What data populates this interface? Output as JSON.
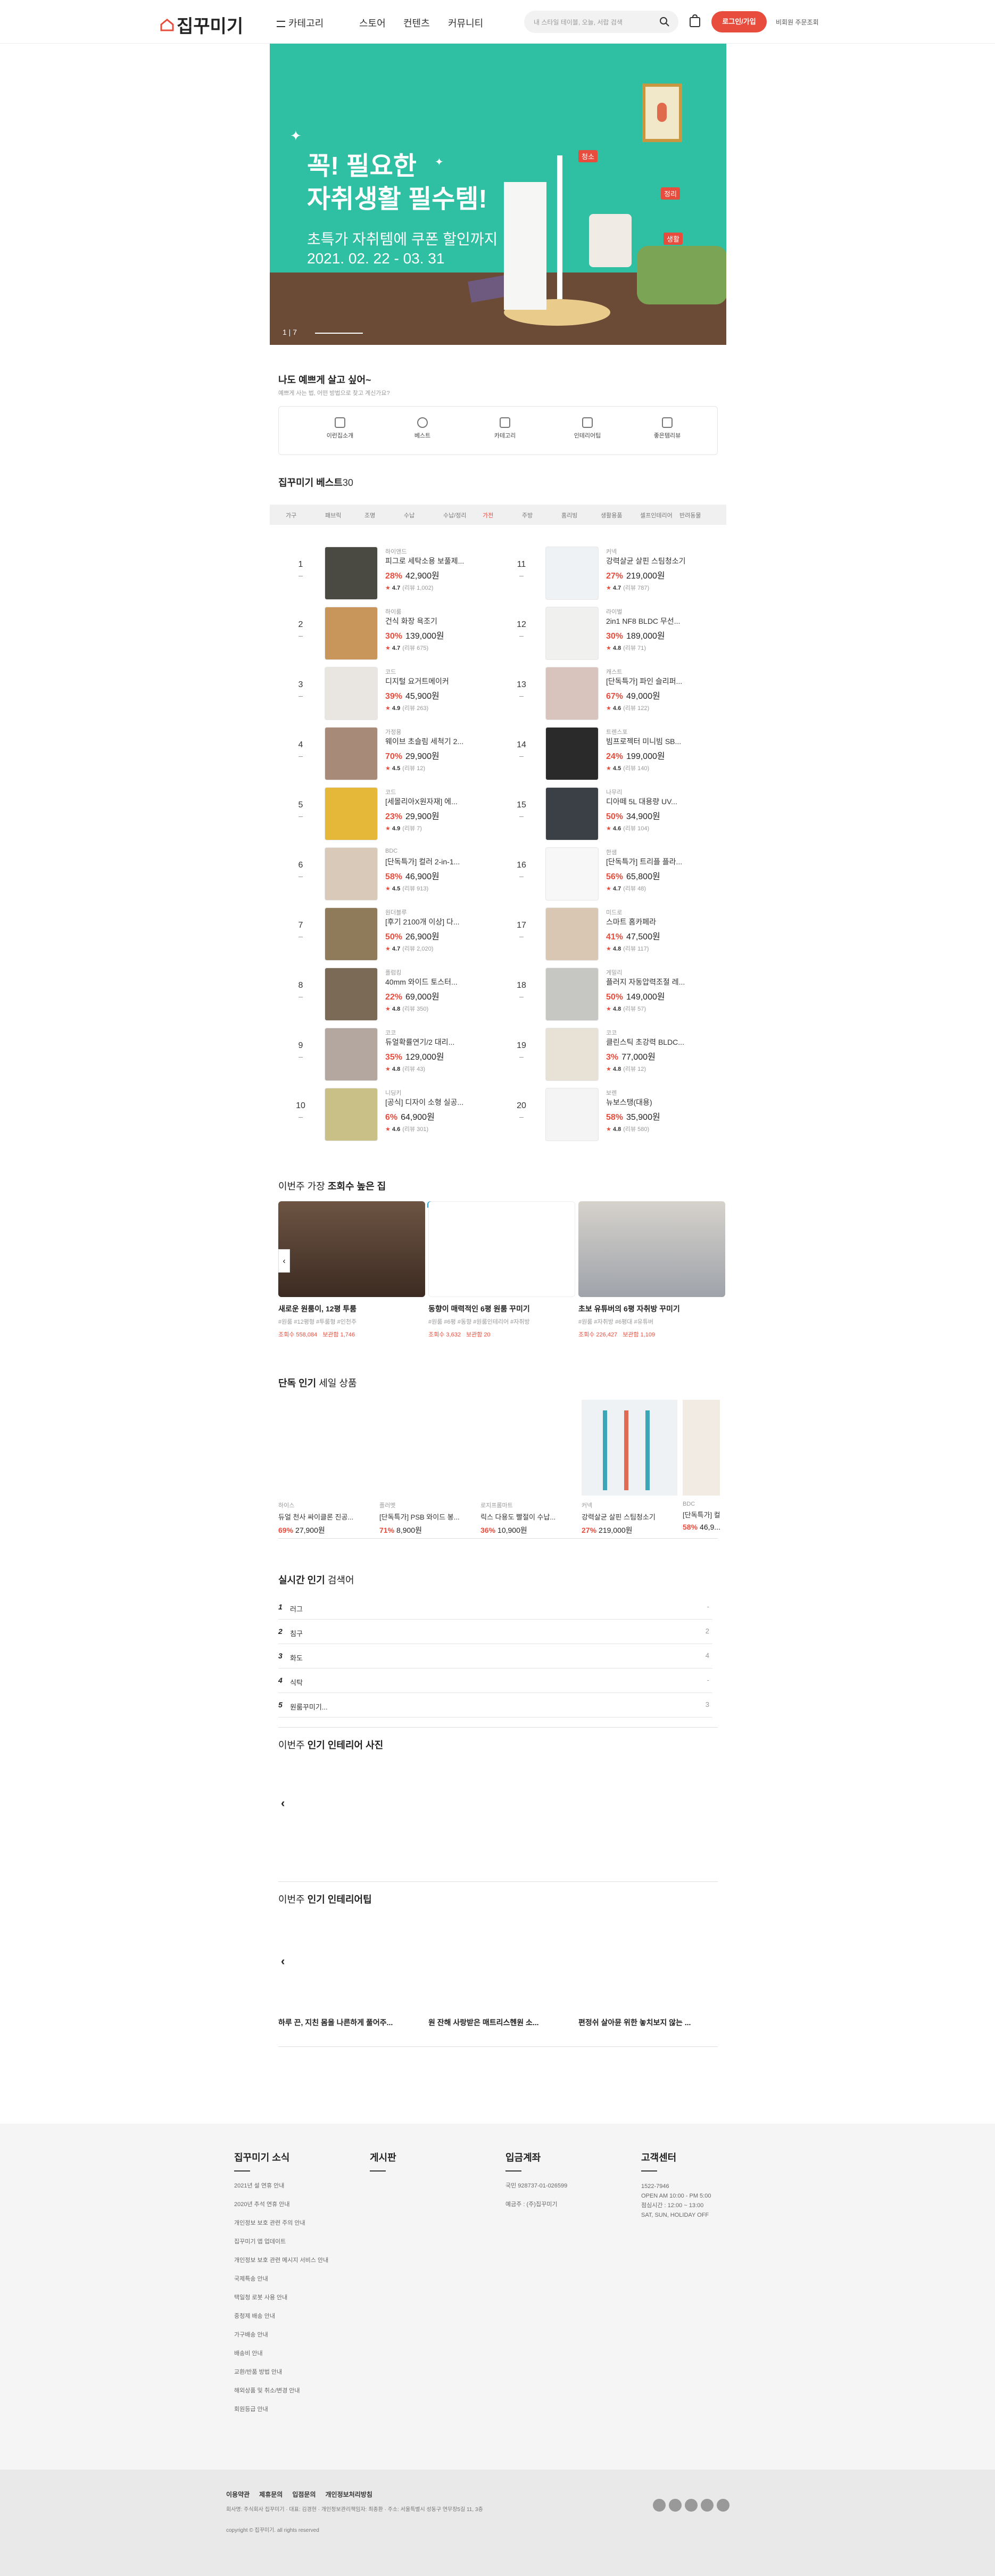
{
  "header": {
    "logo": "집꾸미기",
    "nav": [
      "카테고리",
      "스토어",
      "컨텐츠",
      "커뮤니티"
    ],
    "search_placeholder": "내 스타일 테이블, 오늘, 서랍 검색",
    "login_label": "로그인/가입",
    "extra_label": "비회원 주문조회"
  },
  "hero": {
    "title_line1": "꼭! 필요한",
    "title_line2": "자취생활 필수템!",
    "subtitle_line1": "초특가 자취템에 쿠폰 할인까지",
    "subtitle_line2": "2021. 02. 22 - 03. 31",
    "pager": "1 | 7",
    "tags": [
      "청소",
      "정리",
      "생활"
    ]
  },
  "categories": {
    "title": "나도 예쁘게 살고 싶어~",
    "subtitle": "예쁘게 사는 법, 어떤 방법으로 찾고 계신가요?",
    "items": [
      "이런집소개",
      "베스트",
      "카테고리",
      "인테리어팁",
      "좋은템리뷰"
    ]
  },
  "best": {
    "title": "집꾸미기 베스트",
    "title_count": "30",
    "tabs": [
      "가구",
      "패브릭",
      "조명",
      "수납",
      "수납/정리",
      "가전",
      "주방",
      "홈리빙",
      "생활용품",
      "셀프인테리어",
      "반려동물"
    ],
    "items": [
      {
        "rank": "1",
        "brand": "하이앤드",
        "name": "피그로 세탁소용 보풀제...",
        "discount": "28%",
        "price": "42,900원",
        "rating": "4.7",
        "reviews": "(리뷰 1,002)",
        "color": "#4a4a42"
      },
      {
        "rank": "2",
        "brand": "하이룸",
        "name": "건식 화장 욕조기",
        "discount": "30%",
        "price": "139,000원",
        "rating": "4.7",
        "reviews": "(리뷰 675)",
        "color": "#c8955a"
      },
      {
        "rank": "3",
        "brand": "코드",
        "name": "디지털 요거트메이커",
        "discount": "39%",
        "price": "45,900원",
        "rating": "4.9",
        "reviews": "(리뷰 263)",
        "color": "#e9e6e2"
      },
      {
        "rank": "4",
        "brand": "가정용",
        "name": "웨이브 초슬림 세척기 2...",
        "discount": "70%",
        "price": "29,900원",
        "rating": "4.5",
        "reviews": "(리뷰 12)",
        "color": "#a88a78"
      },
      {
        "rank": "5",
        "brand": "코드",
        "name": "[세몰리아X원자재] 에...",
        "discount": "23%",
        "price": "29,900원",
        "rating": "4.9",
        "reviews": "(리뷰 7)",
        "color": "#e5b83a"
      },
      {
        "rank": "6",
        "brand": "BDC",
        "name": "[단독특가] 컬러 2-in-1...",
        "discount": "58%",
        "price": "46,900원",
        "rating": "4.5",
        "reviews": "(리뷰 913)",
        "color": "#d9c9b8"
      },
      {
        "rank": "7",
        "brand": "원더블루",
        "name": "[후기 2100개 이상] 다...",
        "discount": "50%",
        "price": "26,900원",
        "rating": "4.7",
        "reviews": "(리뷰 2,020)",
        "color": "#8f7a5a"
      },
      {
        "rank": "8",
        "brand": "플럼킹",
        "name": "40mm 와이드 토스터...",
        "discount": "22%",
        "price": "69,000원",
        "rating": "4.8",
        "reviews": "(리뷰 350)",
        "color": "#7a6a56"
      },
      {
        "rank": "9",
        "brand": "코코",
        "name": "듀얼확률연기/2 대리...",
        "discount": "35%",
        "price": "129,000원",
        "rating": "4.8",
        "reviews": "(리뷰 43)",
        "color": "#b3a7a0"
      },
      {
        "rank": "10",
        "brand": "니딩키",
        "name": "[공식] 디자이 소형 실공...",
        "discount": "6%",
        "price": "64,900원",
        "rating": "4.6",
        "reviews": "(리뷰 301)",
        "color": "#c9c088"
      },
      {
        "rank": "11",
        "brand": "커넥",
        "name": "강력살균 살핀 스팀청소기",
        "discount": "27%",
        "price": "219,000원",
        "rating": "4.7",
        "reviews": "(리뷰 787)",
        "color": "#eef2f4"
      },
      {
        "rank": "12",
        "brand": "라이벌",
        "name": "2in1 NF8 BLDC 무선...",
        "discount": "30%",
        "price": "189,000원",
        "rating": "4.8",
        "reviews": "(리뷰 71)",
        "color": "#f0f0ee"
      },
      {
        "rank": "13",
        "brand": "캐스트",
        "name": "[단독특가] 파인 슬리퍼...",
        "discount": "67%",
        "price": "49,000원",
        "rating": "4.6",
        "reviews": "(리뷰 122)",
        "color": "#d8c4bc"
      },
      {
        "rank": "14",
        "brand": "트렌스포",
        "name": "빔프로젝터 미니빔 SB...",
        "discount": "24%",
        "price": "199,000원",
        "rating": "4.5",
        "reviews": "(리뷰 140)",
        "color": "#2a2a2a"
      },
      {
        "rank": "15",
        "brand": "나무리",
        "name": "디아떼 5L 대용량 UV...",
        "discount": "50%",
        "price": "34,900원",
        "rating": "4.6",
        "reviews": "(리뷰 104)",
        "color": "#3b4046"
      },
      {
        "rank": "16",
        "brand": "한샘",
        "name": "[단독특가] 트리플 플라...",
        "discount": "56%",
        "price": "65,800원",
        "rating": "4.7",
        "reviews": "(리뷰 48)",
        "color": "#f7f7f7"
      },
      {
        "rank": "17",
        "brand": "미드로",
        "name": "스마트 홈카페라",
        "discount": "41%",
        "price": "47,500원",
        "rating": "4.8",
        "reviews": "(리뷰 117)",
        "color": "#d9c7b3"
      },
      {
        "rank": "18",
        "brand": "게밀리",
        "name": "플러지 자동압력조절 레...",
        "discount": "50%",
        "price": "149,000원",
        "rating": "4.8",
        "reviews": "(리뷰 57)",
        "color": "#c6c6c2"
      },
      {
        "rank": "19",
        "brand": "코코",
        "name": "클린스틱 초강력 BLDC...",
        "discount": "3%",
        "price": "77,000원",
        "rating": "4.8",
        "reviews": "(리뷰 12)",
        "color": "#e8e1d5"
      },
      {
        "rank": "20",
        "brand": "보렌",
        "name": "뉴보스탱(대용)",
        "discount": "58%",
        "price": "35,900원",
        "rating": "4.8",
        "reviews": "(리뷰 580)",
        "color": "#f4f4f4"
      }
    ]
  },
  "houses": {
    "title_prefix": "이번주 가장",
    "title_bold": "조회수 높은 집",
    "cards": [
      {
        "title": "새로운 원룸이, 12평 투룸",
        "meta": "#원룸 #12평형 #투룸형 #인천주",
        "views": "조회수 558,084",
        "saves": "보관함 1,746",
        "color": "#5b4434"
      },
      {
        "title": "동향이 매력적인 6평 원룸 꾸미기",
        "meta": "#원룸 #6평 #동향 #원룸인테리어 #자취방",
        "views": "조회수 3,632",
        "saves": "보관함 20",
        "color": "#ffffff"
      },
      {
        "title": "초보 유튜버의 6평 자취방 꾸미기",
        "meta": "#원룸 #자취방 #6평대 #유튜버",
        "views": "조회수 226,427",
        "saves": "보관함 1,109",
        "color": "#cfcbc5"
      }
    ]
  },
  "exclusive": {
    "title_bold": "단독 인기",
    "title_rest": "세일 상품",
    "products": [
      {
        "brand": "하이스",
        "name": "듀얼 천사 싸이클론 진공...",
        "discount": "69%",
        "price": "27,900원"
      },
      {
        "brand": "플러멧",
        "name": "[단독특가] PSB 와이드 봉...",
        "discount": "71%",
        "price": "8,900원"
      },
      {
        "brand": "로지프롬마트",
        "name": "릭스 다용도 빨절이 수납...",
        "discount": "36%",
        "price": "10,900원"
      },
      {
        "brand": "커넥",
        "name": "강력살균 살핀 스팀청소기",
        "discount": "27%",
        "price": "219,000원"
      },
      {
        "brand": "BDC",
        "name": "[단독특가] 컬...",
        "discount": "58%",
        "price": "46,9..."
      }
    ]
  },
  "keywords": {
    "title_bold": "실시간 인기",
    "title_rest": "검색어",
    "items": [
      {
        "rank": "1",
        "term": "러그",
        "change": "-"
      },
      {
        "rank": "2",
        "term": "침구",
        "change": "2"
      },
      {
        "rank": "3",
        "term": "화도",
        "change": "4"
      },
      {
        "rank": "4",
        "term": "식탁",
        "change": "-"
      },
      {
        "rank": "5",
        "term": "원룸꾸미기...",
        "change": "3"
      }
    ]
  },
  "photos": {
    "title_prefix": "이번주",
    "title_bold": "인기 인테리어 사진"
  },
  "tips": {
    "title_prefix": "이번주",
    "title_bold": "인기 인테리어팁",
    "items": [
      "하루 끈, 지친 몸을 나른하게 풀어주...",
      "원 잔해 사랑받은 매트리스헨원 소...",
      "편정쉬 살아뮨 위한 놓치보지 않는 ..."
    ]
  },
  "footer": {
    "columns": [
      {
        "title": "집꾸미기 소식",
        "links": [
          "2021년 설 연휴 안내",
          "2020년 추석 연휴 안내",
          "개인정보 보호 관련 주의 안내",
          "집꾸미기 앱 업데이트",
          "개인정보 보호 관련 메시지 서비스 안내",
          "국제특송 안내",
          "택일청 로봇 사용 안내",
          "중청제 배송 안내",
          "가구배송 안내",
          "배송비 안내",
          "교환/반품 방법 안내",
          "해외상품 및 취소/변경 안내",
          "회원등급 안내"
        ]
      },
      {
        "title": "게시판",
        "links": []
      },
      {
        "title": "입금계좌",
        "links": [
          "국민 928737-01-026599",
          "예금주 : (주)집꾸미기"
        ]
      },
      {
        "title": "고객센터",
        "links": [
          "1522-7946",
          "OPEN AM 10:00 - PM 5:00",
          "점심시간 : 12:00 ~ 13:00",
          "SAT, SUN, HOLIDAY OFF"
        ]
      }
    ],
    "bottom_links": [
      "이용약관",
      "제휴문의",
      "입점문의",
      "개인정보처리방침"
    ],
    "company_info": "회사명: 주식회사 집꾸미기 · 대표: 김경현 · 개인정보관리책임자: 최종환 · 주소: 서울특별시 성동구 연무장5길 11, 3층",
    "copyright": "copyright © 집꾸미기. all rights reserved"
  },
  "colors": {
    "accent": "#e74c3c",
    "hero_bg": "#2fbfa3",
    "footer_bg": "#f5f5f5"
  }
}
